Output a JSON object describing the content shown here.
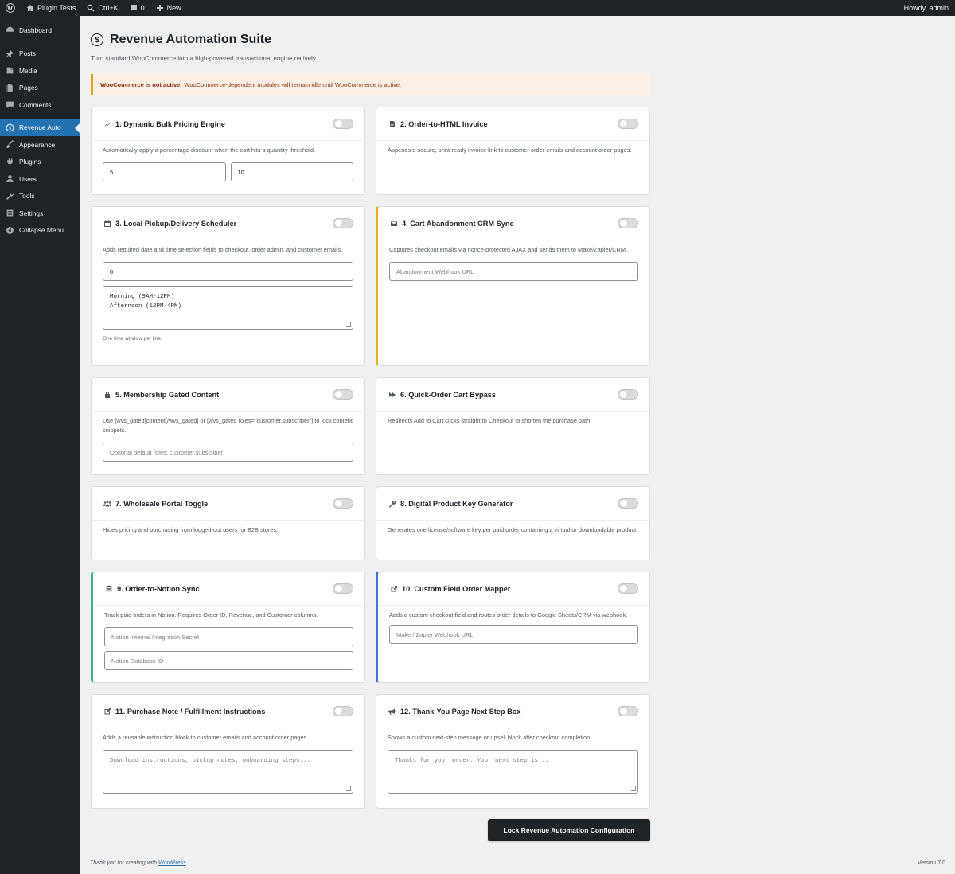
{
  "adminbar": {
    "site_name": "Plugin Tests",
    "search_shortcut": "Ctrl+K",
    "comments_count": "0",
    "new_label": "New",
    "howdy": "Howdy, admin"
  },
  "sidebar": {
    "items": [
      {
        "label": "Dashboard",
        "icon": "dashboard-icon"
      },
      {
        "label": "Posts",
        "icon": "pin-icon"
      },
      {
        "label": "Media",
        "icon": "media-icon"
      },
      {
        "label": "Pages",
        "icon": "pages-icon"
      },
      {
        "label": "Comments",
        "icon": "comments-icon"
      },
      {
        "label": "Revenue Auto",
        "icon": "dollar-icon"
      },
      {
        "label": "Appearance",
        "icon": "brush-icon"
      },
      {
        "label": "Plugins",
        "icon": "plugin-icon"
      },
      {
        "label": "Users",
        "icon": "users-icon"
      },
      {
        "label": "Tools",
        "icon": "wrench-icon"
      },
      {
        "label": "Settings",
        "icon": "settings-icon"
      },
      {
        "label": "Collapse Menu",
        "icon": "collapse-icon"
      }
    ]
  },
  "header": {
    "title_icon": "$",
    "title": "Revenue Automation Suite",
    "subtitle": "Turn standard WooCommerce into a high-powered transactional engine natively."
  },
  "notice": {
    "strong": "WooCommerce is not active.",
    "text": "WooCommerce-dependent modules will remain idle until WooCommerce is active."
  },
  "modules": {
    "m1": {
      "title": "1. Dynamic Bulk Pricing Engine",
      "icon": "chart-icon",
      "desc": "Automatically apply a percentage discount when the cart hits a quantity threshold.",
      "value_a": "5",
      "value_b": "10"
    },
    "m2": {
      "title": "2. Order-to-HTML Invoice",
      "icon": "invoice-icon",
      "desc": "Appends a secure, print-ready invoice link to customer order emails and account order pages."
    },
    "m3": {
      "title": "3. Local Pickup/Delivery Scheduler",
      "icon": "calendar-icon",
      "desc": "Adds required date and time selection fields to checkout, order admin, and customer emails.",
      "value": "0",
      "slots_line1": "Morning (9AM-12PM)",
      "slots_line2": "Afternoon (12PM-4PM)",
      "help": "One time window per line."
    },
    "m4": {
      "title": "4. Cart Abandonment CRM Sync",
      "icon": "email-icon",
      "desc": "Captures checkout emails via nonce-protected AJAX and sends them to Make/Zapier/CRM.",
      "placeholder": "Abandonment Webhook URL"
    },
    "m5": {
      "title": "5. Membership Gated Content",
      "icon": "lock-icon",
      "desc": "Use [wvs_gated]content[/wvs_gated] or [wvs_gated roles=\"customer,subscriber\"] to lock content snippets.",
      "placeholder": "Optional default roles: customer,subscriber"
    },
    "m6": {
      "title": "6. Quick-Order Cart Bypass",
      "icon": "fast-forward-icon",
      "desc": "Redirects Add to Cart clicks straight to Checkout to shorten the purchase path."
    },
    "m7": {
      "title": "7. Wholesale Portal Toggle",
      "icon": "groups-icon",
      "desc": "Hides pricing and purchasing from logged-out users for B2B stores."
    },
    "m8": {
      "title": "8. Digital Product Key Generator",
      "icon": "key-icon",
      "desc": "Generates one license/software key per paid order containing a virtual or downloadable product."
    },
    "m9": {
      "title": "9. Order-to-Notion Sync",
      "icon": "database-icon",
      "desc": "Track paid orders in Notion. Requires Order ID, Revenue, and Customer columns.",
      "placeholder_secret": "Notion Internal Integration Secret",
      "placeholder_db": "Notion Database ID"
    },
    "m10": {
      "title": "10. Custom Field Order Mapper",
      "icon": "external-icon",
      "desc": "Adds a custom checkout field and routes order details to Google Sheets/CRM via webhook.",
      "placeholder": "Make / Zapier Webhook URL"
    },
    "m11": {
      "title": "11. Purchase Note / Fulfillment Instructions",
      "icon": "edit-icon",
      "desc": "Adds a reusable instruction block to customer emails and account order pages.",
      "placeholder": "Download instructions, pickup notes, onboarding steps..."
    },
    "m12": {
      "title": "12. Thank-You Page Next Step Box",
      "icon": "megaphone-icon",
      "desc": "Shows a custom next-step message or upsell block after checkout completion.",
      "placeholder": "Thanks for your order. Your next step is..."
    }
  },
  "submit_label": "Lock Revenue Automation Configuration",
  "footer": {
    "thanks_prefix": "Thank you for creating with",
    "link": "WordPress",
    "thanks_suffix": ".",
    "version": "Version 7.0"
  },
  "colors": {
    "active_menu": "#2271b1",
    "accent_orange": "#f0a823",
    "accent_green": "#2fbd79",
    "accent_blue": "#3a72e0",
    "button": "#1d2327"
  }
}
